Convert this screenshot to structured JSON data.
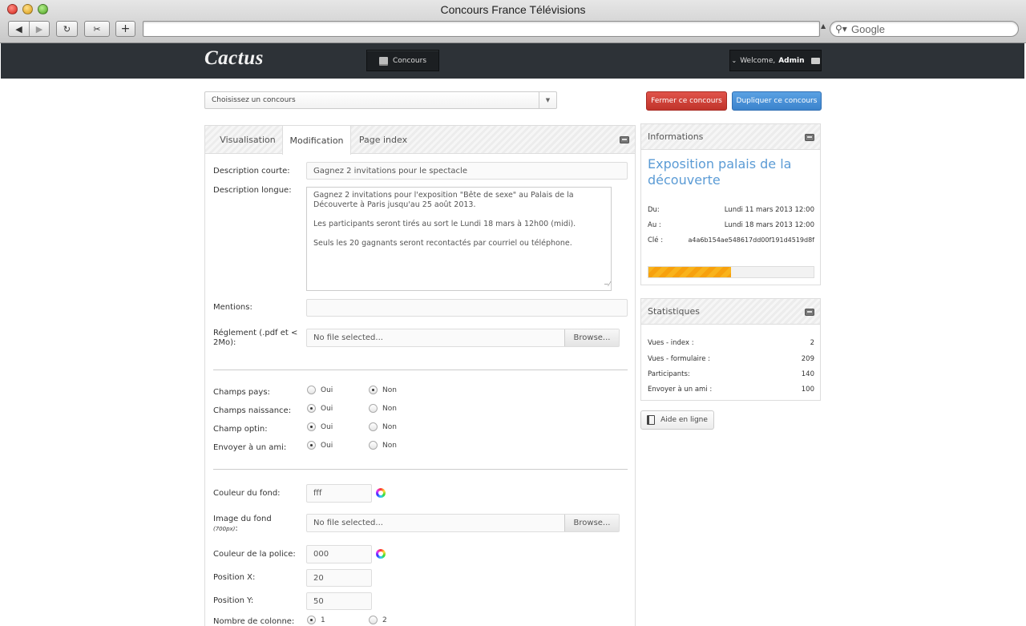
{
  "window": {
    "title": "Concours France Télévisions"
  },
  "browser": {
    "back_icon": "back-arrow-icon",
    "forward_icon": "forward-arrow-icon",
    "reload_icon": "reload-icon",
    "search_placeholder": "Google",
    "url": ""
  },
  "header": {
    "logo": "Cactus",
    "nav_tab": "Concours",
    "welcome_prefix": "Welcome,",
    "welcome_user": "Admin"
  },
  "toolbar": {
    "select_label": "Choisissez un concours",
    "close_button": "Fermer ce concours",
    "duplicate_button": "Dupliquer ce concours"
  },
  "tabs": [
    "Visualisation",
    "Modification",
    "Page index"
  ],
  "form": {
    "short_desc_label": "Description courte:",
    "short_desc_value": "Gagnez 2 invitations pour le spectacle",
    "long_desc_label": "Description longue:",
    "long_desc_paragraphs": [
      "Gagnez 2 invitations pour l'exposition \"Bête de sexe\" au Palais de la Découverte à Paris jusqu'au 25 août 2013.",
      "Les participants seront tirés au sort le Lundi 18 mars à 12h00 (midi).",
      "Seuls les 20 gagnants seront recontactés par courriel ou téléphone."
    ],
    "mentions_label": "Mentions:",
    "mentions_value": "",
    "reglement_label_1": "Réglement (.pdf et <",
    "reglement_label_2": "2Mo):",
    "file_placeholder": "No file selected...",
    "browse_label": "Browse...",
    "oui": "Oui",
    "non": "Non",
    "radios": [
      {
        "label": "Champs pays:",
        "selected": "non"
      },
      {
        "label": "Champs naissance:",
        "selected": "oui"
      },
      {
        "label": "Champ optin:",
        "selected": "oui"
      },
      {
        "label": "Envoyer à un ami:",
        "selected": "oui"
      }
    ],
    "bg_color_label": "Couleur du fond:",
    "bg_color_value": "fff",
    "bg_image_label": "Image du fond",
    "bg_image_sub": "(700px)",
    "bg_image_colon": ":",
    "font_color_label": "Couleur de la police:",
    "font_color_value": "000",
    "pos_x_label": "Position X:",
    "pos_x_value": "20",
    "pos_y_label": "Position Y:",
    "pos_y_value": "50",
    "columns_label": "Nombre de colonne:",
    "col_opt_1": "1",
    "col_opt_2": "2"
  },
  "info": {
    "heading": "Informations",
    "title": "Exposition palais de la découverte",
    "du_label": "Du:",
    "du_value": "Lundi 11 mars 2013 12:00",
    "au_label": "Au :",
    "au_value": "Lundi 18 mars 2013 12:00",
    "cle_label": "Clé :",
    "cle_value": "a4a6b154ae548617dd00f191d4519d8f",
    "progress": 0.5
  },
  "stats": {
    "heading": "Statistiques",
    "rows": [
      {
        "label": "Vues - index :",
        "value": "2"
      },
      {
        "label": "Vues - formulaire :",
        "value": "209"
      },
      {
        "label": "Participants:",
        "value": "140"
      },
      {
        "label": "Envoyer à un ami :",
        "value": "100"
      }
    ]
  },
  "help_button": "Aide en ligne",
  "colors": {
    "accent_blue": "#3b83cc",
    "danger_red": "#c0342b",
    "header_dark": "#2d3237",
    "title_blue": "#5b9bd5",
    "progress_orange": "#f9b31c"
  }
}
